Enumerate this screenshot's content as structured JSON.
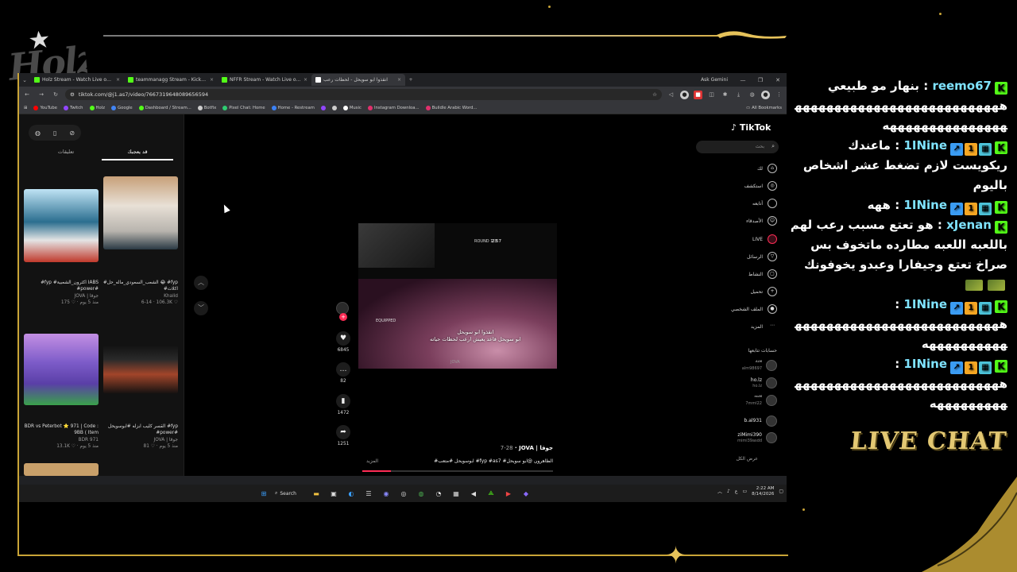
{
  "overlay": {
    "logo_text": "Holz",
    "live_chat_title": "LIVE CHAT"
  },
  "browser": {
    "tabs": [
      {
        "title": "Holz Stream - Watch Live on Ki",
        "color": "#53fc18",
        "active": false
      },
      {
        "title": "teammanagg Stream - Kick Da",
        "color": "#53fc18",
        "active": false
      },
      {
        "title": "NFFR Stream - Watch Live on K",
        "color": "#53fc18",
        "active": false
      },
      {
        "title": "انقذوا ابو سويحل - لحظات رعب",
        "color": "#ffffff",
        "active": true
      }
    ],
    "ask_gemini": "Ask Gemini",
    "url": "tiktok.com/@j1.as7/video/7667319648089656594",
    "bookmarks": [
      {
        "label": "YouTube",
        "color": "#ff0000"
      },
      {
        "label": "Twitch",
        "color": "#9146ff"
      },
      {
        "label": "Holz",
        "color": "#53fc18"
      },
      {
        "label": "Google",
        "color": "#4285f4"
      },
      {
        "label": "Dashboard / Stream...",
        "color": "#53fc18"
      },
      {
        "label": "Botfix",
        "color": "#cccccc"
      },
      {
        "label": "Pixel Chat: Home",
        "color": "#2ecc71"
      },
      {
        "label": "Home - Restream",
        "color": "#3b82f6"
      },
      {
        "label": "",
        "color": "#9146ff"
      },
      {
        "label": "",
        "color": "#cccccc"
      },
      {
        "label": "Music",
        "color": "#ffffff"
      },
      {
        "label": "Instagram Downloa...",
        "color": "#e1306c"
      },
      {
        "label": "Buildle Arabic Word...",
        "color": "#e1306c"
      }
    ],
    "all_bookmarks": "All Bookmarks"
  },
  "tiktok": {
    "logo": "TikTok",
    "search_placeholder": "بحث",
    "left_tabs": {
      "foryou": "قد يعجبك",
      "comments": "تعليقات"
    },
    "related": [
      {
        "title": "#fyp #اكثرون_الشعبية IABS #power#",
        "author": "JOVA | جوقا",
        "stats": "175 ♡ · منذ 5 يوم",
        "bg": "linear-gradient(180deg,#bfe3f4 0%,#2b6e8f 45%,#e4e4e4 70%,#c0392b 100%)"
      },
      {
        "title": "#الشعب_السعودي_ماله_حل 😂 #fyp #اكلات",
        "author": "Khalid",
        "stats": "6-14 · 106.3K ♡",
        "bg": "linear-gradient(180deg,#c7a079 0%,#e8e0d6 40%,#b8b4ae 75%,#2a3a44 100%)"
      },
      {
        "title": "BDR vs Peterbot ⭐ 971 | Code : 9BB ( Item",
        "author": "BDR 971",
        "stats": "13.1K ♡ · منذ 5 يوم",
        "bg": "linear-gradient(180deg,#c38fe3 0%,#7d5cc9 40%,#5a3fa7 70%,#3aa14b 100%)"
      },
      {
        "title": "القسر كليب ابزله #ابوسويحل #fyp #power#",
        "author": "JOVA | جوقا",
        "stats": "81 ♡ · منذ 5 يوم",
        "bg": "linear-gradient(180deg,#111 0%,#2a2a2a 30%,#a2452a 60%,#111 100%)"
      }
    ],
    "video": {
      "round": "ROUND 1/3",
      "timer": "2:57",
      "equipped": "EQUIPPED",
      "caption_line1": "انقذوا ابو سويحل",
      "caption_line2": "ابو سويحل قاعد يعيش ارعب لحظات حياته",
      "watermark": "JOVA",
      "progress": 0.15
    },
    "actions": {
      "likes": "6845",
      "comments": "82",
      "saves": "1472",
      "shares": "1251"
    },
    "post": {
      "author": "JOVA | جوقا",
      "date": "7-28",
      "description": "#ابوسويحل #متعب #fyp #as7 #الظاهرون @ابو سويحل",
      "more": "المزيد"
    },
    "nav": [
      {
        "label": "لك",
        "icon": "⌂",
        "live": false
      },
      {
        "label": "استكشف",
        "icon": "◎",
        "live": false
      },
      {
        "label": "أتابعه",
        "icon": "○",
        "live": false
      },
      {
        "label": "الأصدقاء",
        "icon": "☺",
        "live": false
      },
      {
        "label": "LIVE",
        "icon": "●",
        "live": true
      },
      {
        "label": "الرسائل",
        "icon": "▽",
        "live": false
      },
      {
        "label": "النشاط",
        "icon": "▢",
        "live": false
      },
      {
        "label": "تحميل",
        "icon": "+",
        "live": false
      },
      {
        "label": "الملف الشخصي",
        "icon": "●",
        "live": false
      },
      {
        "label": "المزيد",
        "icon": "…",
        "live": false
      }
    ],
    "following_header": "حسابات تتابعها",
    "following": [
      {
        "name": "ᴬᴸᴹ",
        "handle": "alm98697"
      },
      {
        "name": "ho.lz",
        "handle": "ho.lz"
      },
      {
        "name": "ᵐᵒᴹ",
        "handle": "7mml22"
      },
      {
        "name": "b.al931",
        "handle": ""
      },
      {
        "name": "ziMimi390",
        "handle": "mimi39asdd"
      }
    ],
    "see_more": "عرض الكل"
  },
  "taskbar": {
    "search": "Search",
    "time": "2:22 AM",
    "date": "8/14/2026",
    "lang": "ع"
  },
  "chat": [
    {
      "user": "reemo67",
      "badges": [],
      "text": "بنهار مو طبيعي ههههههههههههههههههههههههههههههههههههههههههه"
    },
    {
      "user": "1INine",
      "badges": [
        "#3b9cf3",
        "#f5a623",
        "#4cc3d9"
      ],
      "text": "ماعندك ريكويست لازم تضغط عشر اشخاص باليوم"
    },
    {
      "user": "1INine",
      "badges": [
        "#3b9cf3",
        "#f5a623",
        "#4cc3d9"
      ],
      "text": "ههه"
    },
    {
      "user": "xJenan",
      "badges": [],
      "text": "هو تعتع مسبب رعب لهم باللعبه اللعبه مطارده ماتخوف بس صراخ تعتع وجيفارا وعبدو يخوفونك"
    },
    {
      "user": "1INine",
      "badges": [
        "#3b9cf3",
        "#f5a623",
        "#4cc3d9"
      ],
      "text": "هههههههههههههههههههههههههههههههههههههه"
    },
    {
      "user": "1INine",
      "badges": [
        "#3b9cf3",
        "#f5a623",
        "#4cc3d9"
      ],
      "text": "ههههههههههههههههههههههههههههههههههههه"
    }
  ]
}
